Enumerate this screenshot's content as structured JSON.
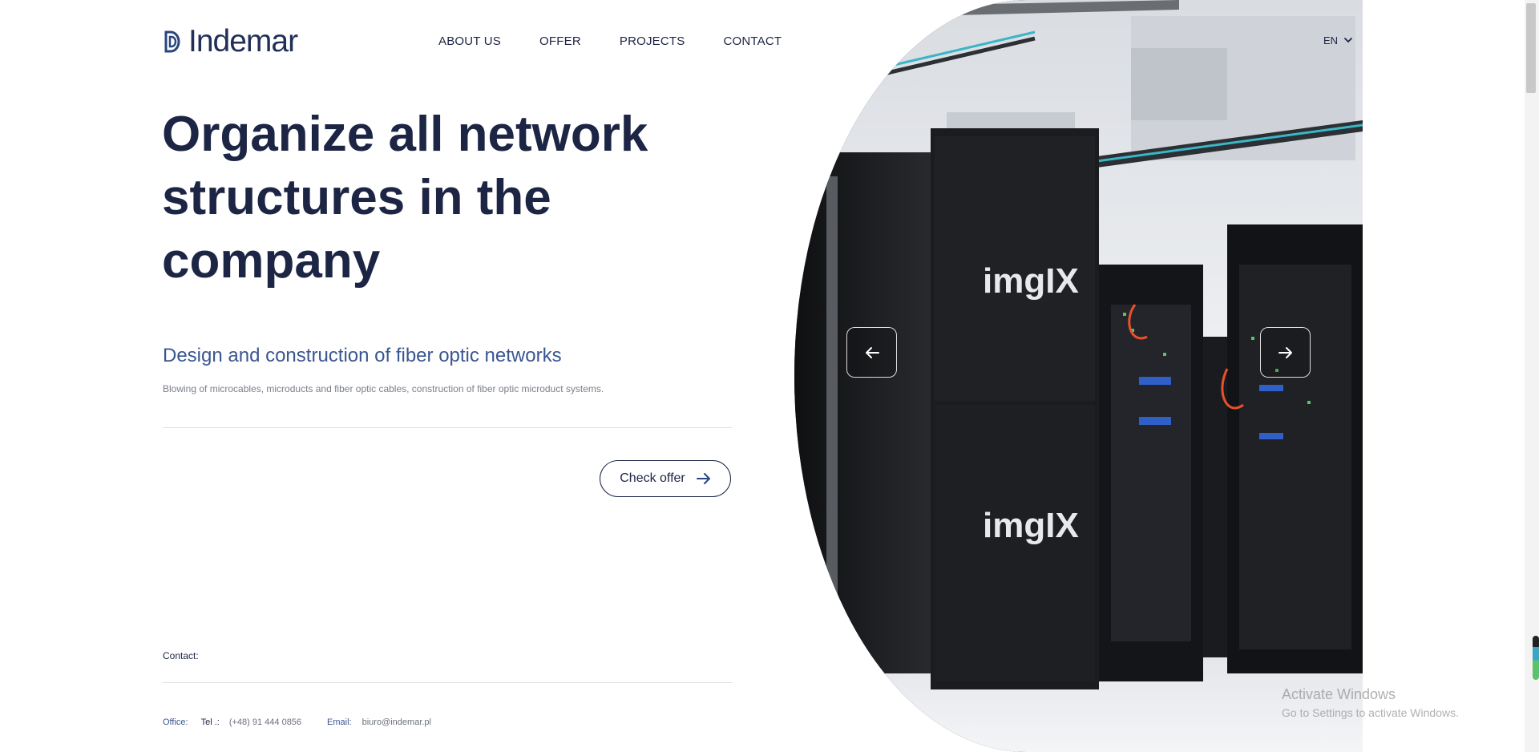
{
  "brand": {
    "name": "Indemar",
    "logo_icon": "indemar-logo-mark",
    "color": "#223058"
  },
  "nav": {
    "items": [
      {
        "label": "ABOUT US"
      },
      {
        "label": "OFFER"
      },
      {
        "label": "PROJECTS"
      },
      {
        "label": "CONTACT"
      }
    ]
  },
  "language": {
    "selected": "EN",
    "icon": "chevron-down-icon"
  },
  "hero": {
    "headline": "Organize all network structures in the company",
    "subheading": "Design and construction of fiber optic networks",
    "description": "Blowing of microcables, microducts and fiber optic cables, construction of fiber optic microduct systems.",
    "cta_label": "Check offer",
    "cta_icon": "arrow-right-icon",
    "prev_icon": "arrow-left-icon",
    "next_icon": "arrow-right-icon",
    "image_brand_text": "imgIX"
  },
  "contact": {
    "heading": "Contact:",
    "office_label": "Office:",
    "tel_label": "Tel .:",
    "tel_value": "(+48) 91 444 0856",
    "email_label": "Email:",
    "email_value": "biuro@indemar.pl"
  },
  "watermark": {
    "line1": "Activate Windows",
    "line2": "Go to Settings to activate Windows."
  },
  "colors": {
    "primary": "#1d2545",
    "accent": "#3a5690",
    "muted": "#7a7f8c"
  }
}
